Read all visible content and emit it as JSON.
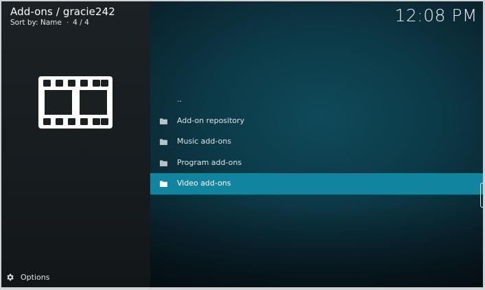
{
  "header": {
    "title": "Add-ons / gracie242",
    "sort_label": "Sort by: Name",
    "position": "4 / 4"
  },
  "clock": "12:08 PM",
  "left_panel": {
    "icon": "film-strip-icon"
  },
  "list": {
    "items": [
      {
        "label": "..",
        "icon": "none",
        "selected": false
      },
      {
        "label": "Add-on repository",
        "icon": "folder-icon",
        "selected": false
      },
      {
        "label": "Music add-ons",
        "icon": "folder-icon",
        "selected": false
      },
      {
        "label": "Program add-ons",
        "icon": "folder-icon",
        "selected": false
      },
      {
        "label": "Video add-ons",
        "icon": "folder-icon",
        "selected": true
      }
    ]
  },
  "footer": {
    "options_label": "Options",
    "icon": "gear-icon"
  },
  "colors": {
    "selection": "#11859f",
    "background_left": "#1b2124",
    "background_right": "#0c3a47"
  }
}
